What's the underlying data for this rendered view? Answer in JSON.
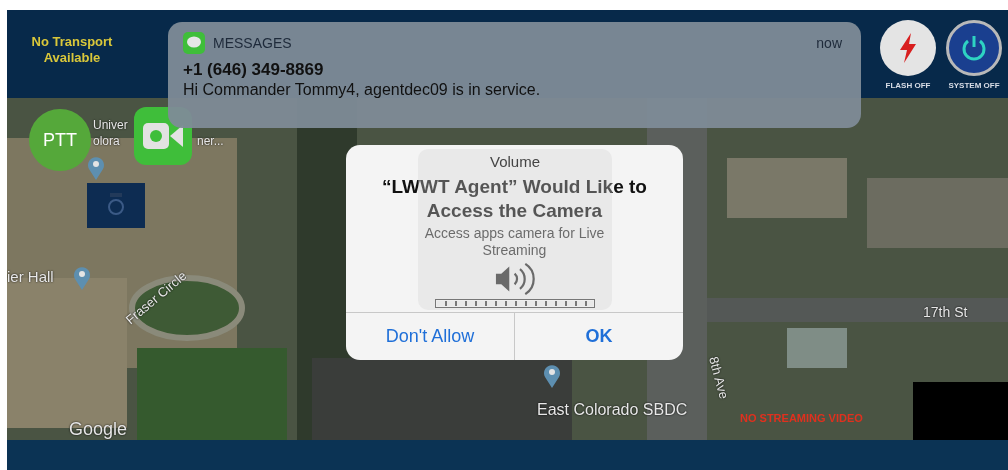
{
  "header": {
    "status": "No Transport Available",
    "buttons": [
      {
        "kind": "flash",
        "label": "FLASH OFF"
      },
      {
        "kind": "power",
        "label": "SYSTEM OFF"
      }
    ]
  },
  "map": {
    "labels": [
      {
        "text": "Univer"
      },
      {
        "text": "olora"
      },
      {
        "text": "ner..."
      },
      {
        "text": "ier Hall"
      },
      {
        "text": "17th St"
      },
      {
        "text": "East Colorado SBDC"
      }
    ],
    "street_labels": [
      {
        "text": "Fraser Circle"
      },
      {
        "text": "8th Ave"
      }
    ],
    "attribution": "Google",
    "video_status": "NO STREAMING VIDEO"
  },
  "controls": [
    {
      "kind": "ptt",
      "label": "PTT"
    },
    {
      "kind": "video"
    },
    {
      "kind": "camera"
    }
  ],
  "notification": {
    "app": "MESSAGES",
    "time": "now",
    "sender": "+1 (646) 349-8869",
    "body": "Hi Commander Tommy4, agentdec09 is in service."
  },
  "alert": {
    "title": "“LWWT Agent” Would Like to Access the Camera",
    "message": "Access apps camera for Live Streaming",
    "buttons": [
      "Don't Allow",
      "OK"
    ]
  },
  "volume_hud": {
    "title": "Volume",
    "level": 1
  }
}
